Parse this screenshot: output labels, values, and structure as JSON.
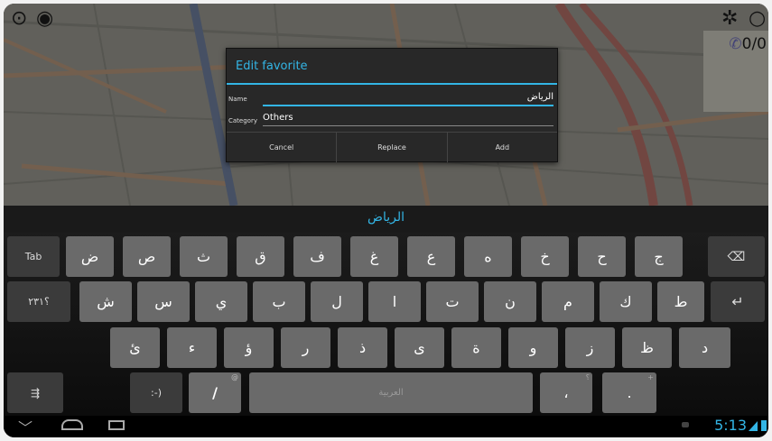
{
  "map": {
    "score": "0/0",
    "icons": [
      "warning-icon",
      "location-icon",
      "settings-icon",
      "circle-icon",
      "phone-icon"
    ]
  },
  "dialog": {
    "title": "Edit favorite",
    "name_label": "Name",
    "name_value": "الرياض",
    "category_label": "Category",
    "category_value": "Others",
    "buttons": {
      "cancel": "Cancel",
      "replace": "Replace",
      "add": "Add"
    }
  },
  "keyboard": {
    "suggestion": "الرياض",
    "row1": [
      "ض",
      "ص",
      "ث",
      "ق",
      "ف",
      "غ",
      "ع",
      "ه",
      "خ",
      "ح",
      "ج"
    ],
    "row2": [
      "ش",
      "س",
      "ي",
      "ب",
      "ل",
      "ا",
      "ت",
      "ن",
      "م",
      "ك",
      "ط"
    ],
    "row3": [
      "ئ",
      "ء",
      "ؤ",
      "ر",
      "ذ",
      "ى",
      "ة",
      "و",
      "ز",
      "ظ",
      "د"
    ],
    "tab_label": "Tab",
    "numbers_label": "؟٢٣١",
    "emoticon_label": ":-)",
    "slash_label": "/",
    "slash_hint": "@",
    "space_label": "العربية",
    "comma_label": "،",
    "comma_hint": "؟",
    "period_label": ".",
    "period_hint": "+",
    "settings_label": "⇶"
  },
  "status": {
    "time": "5:13"
  }
}
